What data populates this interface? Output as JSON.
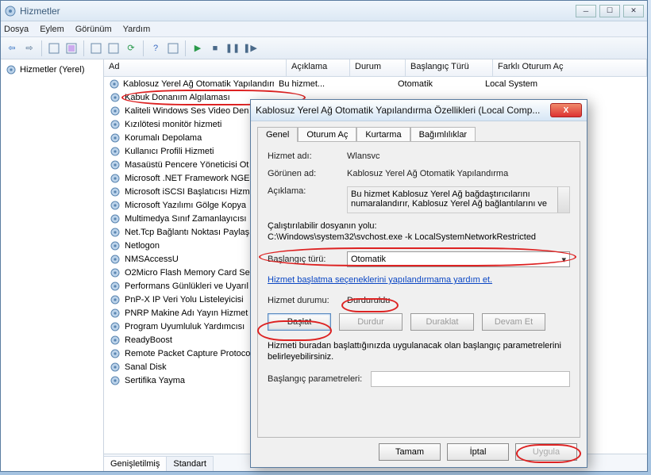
{
  "window": {
    "title": "Hizmetler",
    "menu": [
      "Dosya",
      "Eylem",
      "Görünüm",
      "Yardım"
    ]
  },
  "leftpane": {
    "root": "Hizmetler (Yerel)"
  },
  "columns": {
    "name": "Ad",
    "desc": "Açıklama",
    "status": "Durum",
    "startup": "Başlangıç Türü",
    "logon": "Farklı Oturum Aç"
  },
  "services": [
    {
      "name": "Kablosuz Yerel Ağ Otomatik Yapılandırma",
      "desc": "Bu hizmet...",
      "status": "",
      "startup": "Otomatik",
      "logon": "Local System",
      "hl": true
    },
    {
      "name": "Kabuk Donanım Algılaması"
    },
    {
      "name": "Kaliteli Windows Ses Video Den"
    },
    {
      "name": "Kızılötesi monitör hizmeti"
    },
    {
      "name": "Korumalı Depolama"
    },
    {
      "name": "Kullanıcı Profili Hizmeti"
    },
    {
      "name": "Masaüstü Pencere Yöneticisi Ot"
    },
    {
      "name": "Microsoft .NET Framework NGE"
    },
    {
      "name": "Microsoft iSCSI Başlatıcısı Hizm"
    },
    {
      "name": "Microsoft Yazılımı Gölge Kopya"
    },
    {
      "name": "Multimedya Sınıf Zamanlayıcısı"
    },
    {
      "name": "Net.Tcp Bağlantı Noktası Paylaş"
    },
    {
      "name": "Netlogon"
    },
    {
      "name": "NMSAccessU"
    },
    {
      "name": "O2Micro Flash Memory Card Se"
    },
    {
      "name": "Performans Günlükleri ve Uyarıl"
    },
    {
      "name": "PnP-X IP Veri Yolu Listeleyicisi"
    },
    {
      "name": "PNRP Makine Adı Yayın Hizmet"
    },
    {
      "name": "Program Uyumluluk Yardımcısı"
    },
    {
      "name": "ReadyBoost"
    },
    {
      "name": "Remote Packet Capture Protoco"
    },
    {
      "name": "Sanal Disk"
    },
    {
      "name": "Sertifika Yayma"
    }
  ],
  "bottom_tabs": {
    "ext": "Genişletilmiş",
    "std": "Standart"
  },
  "dialog": {
    "title": "Kablosuz Yerel Ağ Otomatik Yapılandırma Özellikleri (Local Comp...",
    "tabs": [
      "Genel",
      "Oturum Aç",
      "Kurtarma",
      "Bağımlılıklar"
    ],
    "lbl_service_name": "Hizmet adı:",
    "val_service_name": "Wlansvc",
    "lbl_display_name": "Görünen ad:",
    "val_display_name": "Kablosuz Yerel Ağ Otomatik Yapılandırma",
    "lbl_description": "Açıklama:",
    "val_description": "Bu hizmet Kablosuz Yerel Ağ bağdaştırıcılarını numaralandırır, Kablosuz Yerel Ağ bağlantılarını ve",
    "lbl_exe_path": "Çalıştırılabilir dosyanın yolu:",
    "val_exe_path": "C:\\Windows\\system32\\svchost.exe -k LocalSystemNetworkRestricted",
    "lbl_startup_type": "Başlangıç türü:",
    "val_startup_type": "Otomatik",
    "help_link": "Hizmet başlatma seçeneklerini yapılandırmama yardım et.",
    "lbl_status": "Hizmet durumu:",
    "val_status": "Durduruldu",
    "btn_start": "Başlat",
    "btn_stop": "Durdur",
    "btn_pause": "Duraklat",
    "btn_resume": "Devam Et",
    "params_note": "Hizmeti buradan başlattığınızda uygulanacak olan başlangıç parametrelerini belirleyebilirsiniz.",
    "lbl_params": "Başlangıç parametreleri:",
    "btn_ok": "Tamam",
    "btn_cancel": "İptal",
    "btn_apply": "Uygula"
  }
}
